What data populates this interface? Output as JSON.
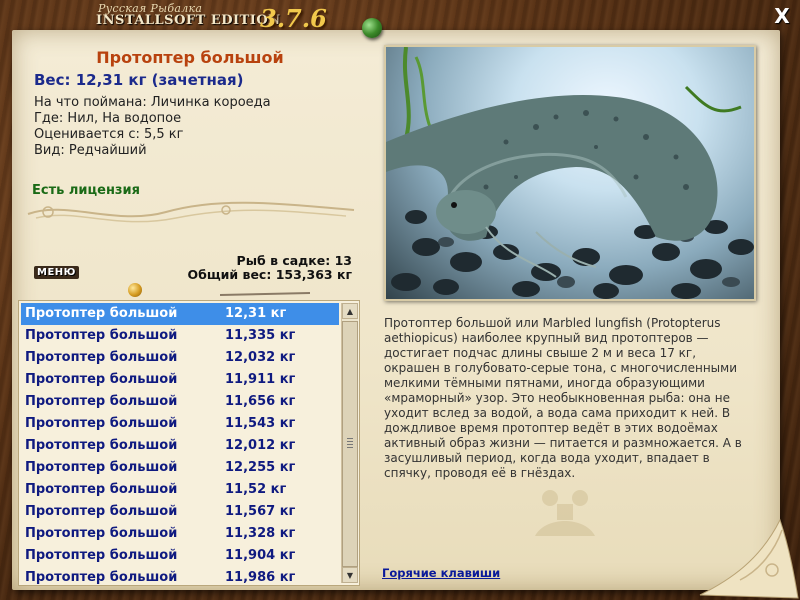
{
  "header": {
    "title_top": "Русская Рыбалка",
    "title_main": "INSTALLSOFT EDITION",
    "version": "3.7.6",
    "close_label": "X"
  },
  "fish": {
    "name": "Протоптер большой",
    "weight": "Вес: 12,31 кг (зачетная)",
    "bait": "На что поймана: Личинка короеда",
    "place": "Где: Нил, На водопое",
    "rated_from": "Оценивается с: 5,5 кг",
    "kind": "Вид: Редчайший",
    "license": "Есть лицензия"
  },
  "keepnet": {
    "count_text": "Рыб в садке: 13",
    "total_text": "Общий вес: 153,363 кг",
    "menu_label": "МЕНЮ"
  },
  "catch_list": [
    {
      "name": "Протоптер большой",
      "weight": "12,31 кг"
    },
    {
      "name": "Протоптер большой",
      "weight": "11,335 кг"
    },
    {
      "name": "Протоптер большой",
      "weight": "12,032 кг"
    },
    {
      "name": "Протоптер большой",
      "weight": "11,911 кг"
    },
    {
      "name": "Протоптер большой",
      "weight": "11,656 кг"
    },
    {
      "name": "Протоптер большой",
      "weight": "11,543 кг"
    },
    {
      "name": "Протоптер большой",
      "weight": "12,012 кг"
    },
    {
      "name": "Протоптер большой",
      "weight": "12,255 кг"
    },
    {
      "name": "Протоптер большой",
      "weight": "11,52 кг"
    },
    {
      "name": "Протоптер большой",
      "weight": "11,567 кг"
    },
    {
      "name": "Протоптер большой",
      "weight": "11,328 кг"
    },
    {
      "name": "Протоптер большой",
      "weight": "11,904 кг"
    },
    {
      "name": "Протоптер большой",
      "weight": "11,986 кг"
    }
  ],
  "selected_index": 0,
  "description": "Протоптер большой или Marbled lungfish (Protopterus aethiopicus) наиболее крупный вид протоптеров — достигает подчас длины свыше 2 м и веса 17 кг, окрашен в голубовато-серые тона, с многочисленными мелкими тёмными пятнами, иногда образующими «мраморный» узор. Это необыкновенная рыба: она не уходит вслед за водой, а вода сама приходит к ней. В дождливое время протоптер ведёт в этих водоёмах активный образ жизни — питается и размножается. А в засушливый период, когда вода уходит, впадает в спячку, проводя её в гнёздах.",
  "hotkeys_label": "Горячие клавиши",
  "icons": {
    "close": "close-icon",
    "scroll_up": "scroll-up-arrow-icon",
    "scroll_down": "scroll-down-arrow-icon"
  },
  "colors": {
    "fish_name": "#b8420e",
    "weight": "#1b2a8c",
    "license": "#1a6a16",
    "selection": "#3e8ee8",
    "list_text": "#0f1a80"
  }
}
